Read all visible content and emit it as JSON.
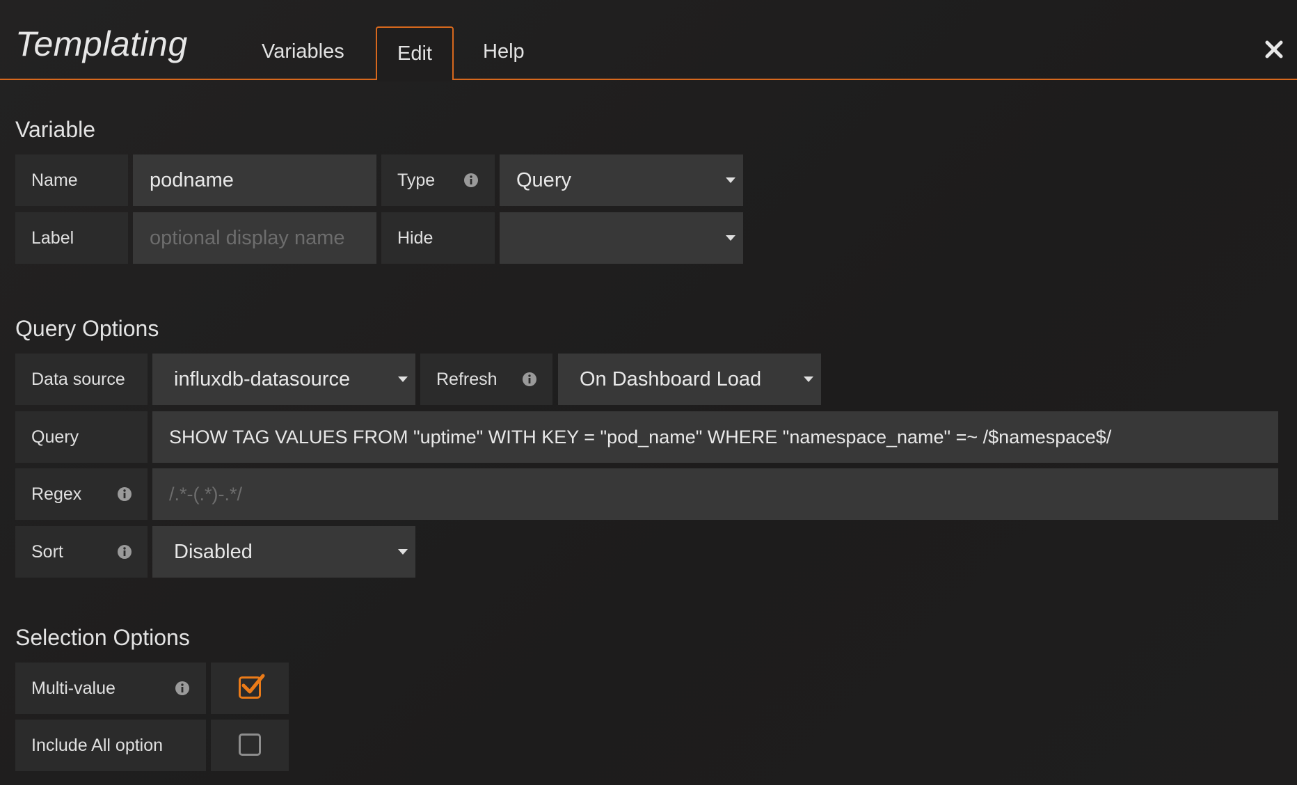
{
  "header": {
    "title": "Templating",
    "tabs": [
      {
        "label": "Variables",
        "active": false
      },
      {
        "label": "Edit",
        "active": true
      },
      {
        "label": "Help",
        "active": false
      }
    ],
    "close_icon": "close-icon"
  },
  "variable": {
    "section_title": "Variable",
    "name_label": "Name",
    "name_value": "podname",
    "type_label": "Type",
    "type_value": "Query",
    "label_label": "Label",
    "label_placeholder": "optional display name",
    "hide_label": "Hide",
    "hide_value": ""
  },
  "query_options": {
    "section_title": "Query Options",
    "datasource_label": "Data source",
    "datasource_value": "influxdb-datasource",
    "refresh_label": "Refresh",
    "refresh_value": "On Dashboard Load",
    "query_label": "Query",
    "query_value": "SHOW TAG VALUES FROM \"uptime\" WITH KEY = \"pod_name\" WHERE \"namespace_name\" =~ /$namespace$/",
    "regex_label": "Regex",
    "regex_placeholder": "/.*-(.*)-.*/",
    "sort_label": "Sort",
    "sort_value": "Disabled"
  },
  "selection_options": {
    "section_title": "Selection Options",
    "multi_value_label": "Multi-value",
    "multi_value_checked": true,
    "include_all_label": "Include All option",
    "include_all_checked": false
  },
  "colors": {
    "accent": "#d7681d",
    "checkbox_accent": "#eb7b18",
    "background": "#1e1d1d",
    "label_bg": "#2b2b2b",
    "field_bg": "#383838"
  }
}
